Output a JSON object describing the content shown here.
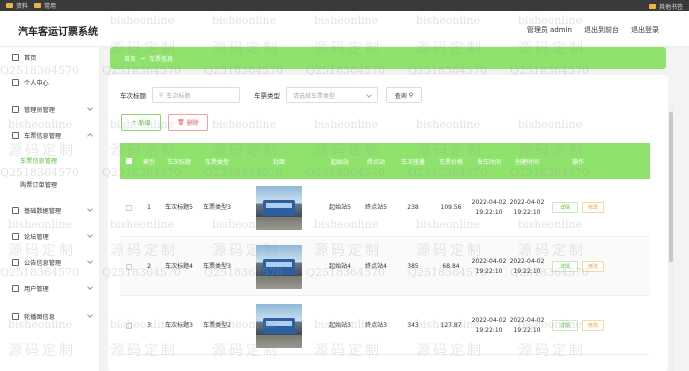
{
  "bookmarks": {
    "items": [
      "资料",
      "常用"
    ],
    "right": "其他书签"
  },
  "header": {
    "brand": "汽车客运订票系统",
    "admin": "管理员 admin",
    "front": "退出到前台",
    "logout": "退出登录"
  },
  "sidebar": {
    "items": [
      {
        "label": "首页",
        "icon": "home-icon"
      },
      {
        "label": "个人中心",
        "icon": "user-icon"
      },
      {
        "label": "管理员管理",
        "icon": "admin-icon"
      },
      {
        "label": "车票信息管理",
        "icon": "ticket-icon"
      },
      {
        "label": "基础数据管理",
        "icon": "data-icon"
      },
      {
        "label": "论坛管理",
        "icon": "forum-icon"
      },
      {
        "label": "公告信息管理",
        "icon": "notice-icon"
      },
      {
        "label": "用户管理",
        "icon": "users-icon"
      },
      {
        "label": "轮播图信息",
        "icon": "carousel-icon"
      }
    ],
    "subs": [
      "车票信息管理",
      "购票订单管理"
    ]
  },
  "breadcrumb": {
    "home": "首页",
    "sep": "→",
    "current": "车票信息"
  },
  "search": {
    "title_label": "车次标题",
    "title_placeholder": "车次标题",
    "type_label": "车票类型",
    "type_placeholder": "请选择车票类型",
    "query_label": "查询"
  },
  "actions": {
    "add": "新增",
    "delete": "删除"
  },
  "table": {
    "headers": [
      "",
      "索引",
      "车次标题",
      "车票类型",
      "封面",
      "起始站",
      "终点站",
      "车次座量",
      "车票价格",
      "发车时间",
      "创建时间",
      "操作"
    ],
    "rows": [
      {
        "index": "1",
        "title": "车次标题5",
        "type": "车票类型3",
        "start": "起始站5",
        "end": "终点站5",
        "seats": "238",
        "price": "109.56",
        "depart": "2022-04-02 19:22:10",
        "created": "2022-04-02 19:22:10"
      },
      {
        "index": "2",
        "title": "车次标题4",
        "type": "车票类型3",
        "start": "起始站4",
        "end": "终点站4",
        "seats": "385",
        "price": "68.84",
        "depart": "2022-04-02 19:22:10",
        "created": "2022-04-02 19:22:10"
      },
      {
        "index": "3",
        "title": "车次标题3",
        "type": "车票类型2",
        "start": "起始站3",
        "end": "终点站3",
        "seats": "343",
        "price": "127.87",
        "depart": "2022-04-02 19:22:10",
        "created": "2022-04-02 19:22:10"
      }
    ],
    "detail": "详情",
    "edit": "修改"
  },
  "watermark": {
    "site": "bisheonline",
    "code": "源码定制",
    "qq": "Q2518364570"
  },
  "colors": {
    "accent": "#8fe36c",
    "active": "#5fbf3a"
  }
}
